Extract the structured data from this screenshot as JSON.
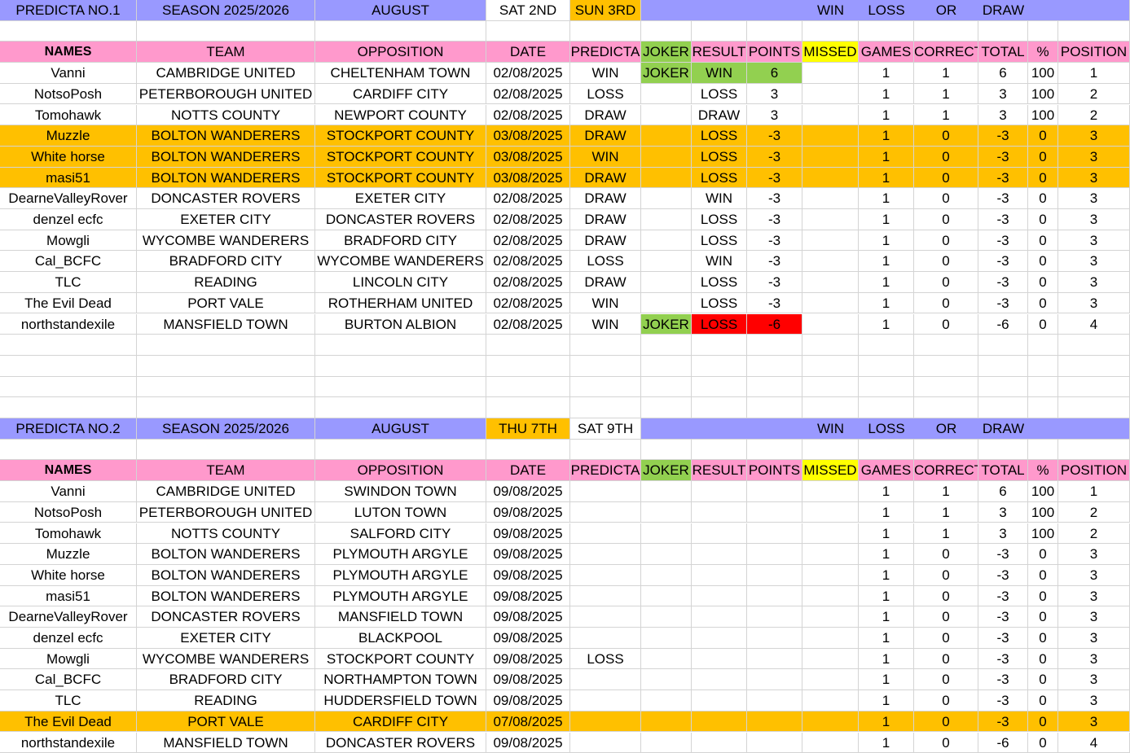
{
  "colors": {
    "title_bar": "#9999ff",
    "header_bar": "#ff99cc",
    "highlight_orange": "#ffc000",
    "joker_green": "#92d050",
    "missed_yellow": "#ffff00",
    "loss_red": "#ff0000",
    "white": "#ffffff"
  },
  "icons": [],
  "headers": [
    "NAMES",
    "TEAM",
    "OPPOSITION",
    "DATE",
    "PREDICTA",
    "JOKER",
    "RESULT",
    "POINTS",
    "MISSED",
    "GAMES",
    "CORRECT",
    "TOTAL",
    "%",
    "POSITION"
  ],
  "sections": [
    {
      "title": {
        "label": "PREDICTA NO.1",
        "season": "SEASON 2025/2026",
        "month": "AUGUST",
        "day1": "SAT 2ND",
        "day2": "SUN 3RD",
        "win": "WIN",
        "loss": "LOSS",
        "or": "OR",
        "draw": "DRAW"
      },
      "highlighted_day": 2,
      "rows": [
        {
          "name": "Vanni",
          "team": "CAMBRIDGE UNITED",
          "opposition": "CHELTENHAM TOWN",
          "date": "02/08/2025",
          "predicta": "WIN",
          "joker": "JOKER",
          "result": "WIN",
          "points": "6",
          "missed": "",
          "games": "1",
          "correct": "1",
          "total": "6",
          "pct": "100",
          "position": "1",
          "style": "joker-win"
        },
        {
          "name": "NotsoPosh",
          "team": "PETERBOROUGH UNITED",
          "opposition": "CARDIFF CITY",
          "date": "02/08/2025",
          "predicta": "LOSS",
          "joker": "",
          "result": "LOSS",
          "points": "3",
          "missed": "",
          "games": "1",
          "correct": "1",
          "total": "3",
          "pct": "100",
          "position": "2",
          "style": ""
        },
        {
          "name": "Tomohawk",
          "team": "NOTTS COUNTY",
          "opposition": "NEWPORT COUNTY",
          "date": "02/08/2025",
          "predicta": "DRAW",
          "joker": "",
          "result": "DRAW",
          "points": "3",
          "missed": "",
          "games": "1",
          "correct": "1",
          "total": "3",
          "pct": "100",
          "position": "2",
          "style": ""
        },
        {
          "name": "Muzzle",
          "team": "BOLTON WANDERERS",
          "opposition": "STOCKPORT COUNTY",
          "date": "03/08/2025",
          "predicta": "DRAW",
          "joker": "",
          "result": "LOSS",
          "points": "-3",
          "missed": "",
          "games": "1",
          "correct": "0",
          "total": "-3",
          "pct": "0",
          "position": "3",
          "style": "orange"
        },
        {
          "name": "White horse",
          "team": "BOLTON WANDERERS",
          "opposition": "STOCKPORT COUNTY",
          "date": "03/08/2025",
          "predicta": "WIN",
          "joker": "",
          "result": "LOSS",
          "points": "-3",
          "missed": "",
          "games": "1",
          "correct": "0",
          "total": "-3",
          "pct": "0",
          "position": "3",
          "style": "orange"
        },
        {
          "name": "masi51",
          "team": "BOLTON WANDERERS",
          "opposition": "STOCKPORT COUNTY",
          "date": "03/08/2025",
          "predicta": "DRAW",
          "joker": "",
          "result": "LOSS",
          "points": "-3",
          "missed": "",
          "games": "1",
          "correct": "0",
          "total": "-3",
          "pct": "0",
          "position": "3",
          "style": "orange"
        },
        {
          "name": "DearneValleyRover",
          "team": "DONCASTER ROVERS",
          "opposition": "EXETER CITY",
          "date": "02/08/2025",
          "predicta": "DRAW",
          "joker": "",
          "result": "WIN",
          "points": "-3",
          "missed": "",
          "games": "1",
          "correct": "0",
          "total": "-3",
          "pct": "0",
          "position": "3",
          "style": ""
        },
        {
          "name": "denzel ecfc",
          "team": "EXETER CITY",
          "opposition": "DONCASTER ROVERS",
          "date": "02/08/2025",
          "predicta": "DRAW",
          "joker": "",
          "result": "LOSS",
          "points": "-3",
          "missed": "",
          "games": "1",
          "correct": "0",
          "total": "-3",
          "pct": "0",
          "position": "3",
          "style": ""
        },
        {
          "name": "Mowgli",
          "team": "WYCOMBE WANDERERS",
          "opposition": "BRADFORD CITY",
          "date": "02/08/2025",
          "predicta": "DRAW",
          "joker": "",
          "result": "LOSS",
          "points": "-3",
          "missed": "",
          "games": "1",
          "correct": "0",
          "total": "-3",
          "pct": "0",
          "position": "3",
          "style": ""
        },
        {
          "name": "Cal_BCFC",
          "team": "BRADFORD CITY",
          "opposition": "WYCOMBE WANDERERS",
          "date": "02/08/2025",
          "predicta": "LOSS",
          "joker": "",
          "result": "WIN",
          "points": "-3",
          "missed": "",
          "games": "1",
          "correct": "0",
          "total": "-3",
          "pct": "0",
          "position": "3",
          "style": ""
        },
        {
          "name": "TLC",
          "team": "READING",
          "opposition": "LINCOLN CITY",
          "date": "02/08/2025",
          "predicta": "DRAW",
          "joker": "",
          "result": "LOSS",
          "points": "-3",
          "missed": "",
          "games": "1",
          "correct": "0",
          "total": "-3",
          "pct": "0",
          "position": "3",
          "style": ""
        },
        {
          "name": "The Evil Dead",
          "team": "PORT VALE",
          "opposition": "ROTHERHAM UNITED",
          "date": "02/08/2025",
          "predicta": "WIN",
          "joker": "",
          "result": "LOSS",
          "points": "-3",
          "missed": "",
          "games": "1",
          "correct": "0",
          "total": "-3",
          "pct": "0",
          "position": "3",
          "style": ""
        },
        {
          "name": "northstandexile",
          "team": "MANSFIELD TOWN",
          "opposition": "BURTON ALBION",
          "date": "02/08/2025",
          "predicta": "WIN",
          "joker": "JOKER",
          "result": "LOSS",
          "points": "-6",
          "missed": "",
          "games": "1",
          "correct": "0",
          "total": "-6",
          "pct": "0",
          "position": "4",
          "style": "joker-loss"
        }
      ]
    },
    {
      "title": {
        "label": "PREDICTA NO.2",
        "season": "SEASON 2025/2026",
        "month": "AUGUST",
        "day1": "THU 7TH",
        "day2": "SAT 9TH",
        "win": "WIN",
        "loss": "LOSS",
        "or": "OR",
        "draw": "DRAW"
      },
      "highlighted_day": 1,
      "rows": [
        {
          "name": "Vanni",
          "team": "CAMBRIDGE UNITED",
          "opposition": "SWINDON TOWN",
          "date": "09/08/2025",
          "predicta": "",
          "joker": "",
          "result": "",
          "points": "",
          "missed": "",
          "games": "1",
          "correct": "1",
          "total": "6",
          "pct": "100",
          "position": "1",
          "style": ""
        },
        {
          "name": "NotsoPosh",
          "team": "PETERBOROUGH UNITED",
          "opposition": "LUTON TOWN",
          "date": "09/08/2025",
          "predicta": "",
          "joker": "",
          "result": "",
          "points": "",
          "missed": "",
          "games": "1",
          "correct": "1",
          "total": "3",
          "pct": "100",
          "position": "2",
          "style": ""
        },
        {
          "name": "Tomohawk",
          "team": "NOTTS COUNTY",
          "opposition": "SALFORD CITY",
          "date": "09/08/2025",
          "predicta": "",
          "joker": "",
          "result": "",
          "points": "",
          "missed": "",
          "games": "1",
          "correct": "1",
          "total": "3",
          "pct": "100",
          "position": "2",
          "style": ""
        },
        {
          "name": "Muzzle",
          "team": "BOLTON WANDERERS",
          "opposition": "PLYMOUTH ARGYLE",
          "date": "09/08/2025",
          "predicta": "",
          "joker": "",
          "result": "",
          "points": "",
          "missed": "",
          "games": "1",
          "correct": "0",
          "total": "-3",
          "pct": "0",
          "position": "3",
          "style": ""
        },
        {
          "name": "White horse",
          "team": "BOLTON WANDERERS",
          "opposition": "PLYMOUTH ARGYLE",
          "date": "09/08/2025",
          "predicta": "",
          "joker": "",
          "result": "",
          "points": "",
          "missed": "",
          "games": "1",
          "correct": "0",
          "total": "-3",
          "pct": "0",
          "position": "3",
          "style": ""
        },
        {
          "name": "masi51",
          "team": "BOLTON WANDERERS",
          "opposition": "PLYMOUTH ARGYLE",
          "date": "09/08/2025",
          "predicta": "",
          "joker": "",
          "result": "",
          "points": "",
          "missed": "",
          "games": "1",
          "correct": "0",
          "total": "-3",
          "pct": "0",
          "position": "3",
          "style": ""
        },
        {
          "name": "DearneValleyRover",
          "team": "DONCASTER ROVERS",
          "opposition": "MANSFIELD TOWN",
          "date": "09/08/2025",
          "predicta": "",
          "joker": "",
          "result": "",
          "points": "",
          "missed": "",
          "games": "1",
          "correct": "0",
          "total": "-3",
          "pct": "0",
          "position": "3",
          "style": ""
        },
        {
          "name": "denzel ecfc",
          "team": "EXETER CITY",
          "opposition": "BLACKPOOL",
          "date": "09/08/2025",
          "predicta": "",
          "joker": "",
          "result": "",
          "points": "",
          "missed": "",
          "games": "1",
          "correct": "0",
          "total": "-3",
          "pct": "0",
          "position": "3",
          "style": ""
        },
        {
          "name": "Mowgli",
          "team": "WYCOMBE WANDERERS",
          "opposition": "STOCKPORT COUNTY",
          "date": "09/08/2025",
          "predicta": "LOSS",
          "joker": "",
          "result": "",
          "points": "",
          "missed": "",
          "games": "1",
          "correct": "0",
          "total": "-3",
          "pct": "0",
          "position": "3",
          "style": ""
        },
        {
          "name": "Cal_BCFC",
          "team": "BRADFORD CITY",
          "opposition": "NORTHAMPTON TOWN",
          "date": "09/08/2025",
          "predicta": "",
          "joker": "",
          "result": "",
          "points": "",
          "missed": "",
          "games": "1",
          "correct": "0",
          "total": "-3",
          "pct": "0",
          "position": "3",
          "style": ""
        },
        {
          "name": "TLC",
          "team": "READING",
          "opposition": "HUDDERSFIELD TOWN",
          "date": "09/08/2025",
          "predicta": "",
          "joker": "",
          "result": "",
          "points": "",
          "missed": "",
          "games": "1",
          "correct": "0",
          "total": "-3",
          "pct": "0",
          "position": "3",
          "style": ""
        },
        {
          "name": "The Evil Dead",
          "team": "PORT VALE",
          "opposition": "CARDIFF CITY",
          "date": "07/08/2025",
          "predicta": "",
          "joker": "",
          "result": "",
          "points": "",
          "missed": "",
          "games": "1",
          "correct": "0",
          "total": "-3",
          "pct": "0",
          "position": "3",
          "style": "orange"
        },
        {
          "name": "northstandexile",
          "team": "MANSFIELD TOWN",
          "opposition": "DONCASTER ROVERS",
          "date": "09/08/2025",
          "predicta": "",
          "joker": "",
          "result": "",
          "points": "",
          "missed": "",
          "games": "1",
          "correct": "0",
          "total": "-6",
          "pct": "0",
          "position": "4",
          "style": ""
        }
      ]
    }
  ]
}
